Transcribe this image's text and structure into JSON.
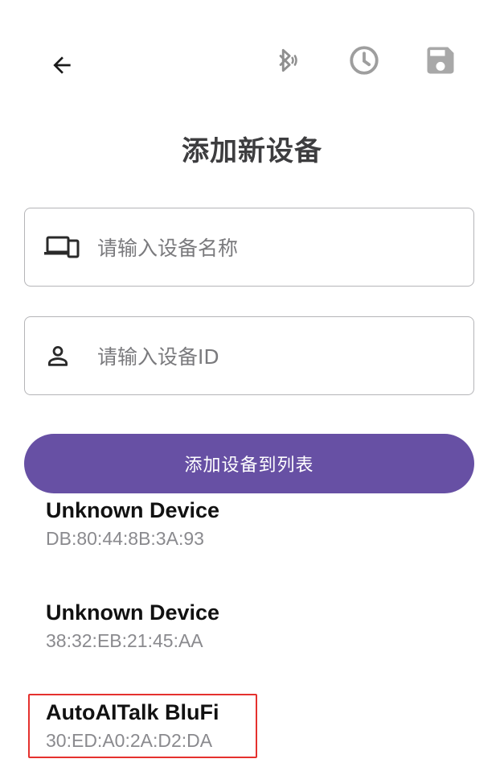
{
  "header": {
    "back_icon": "arrow-left-icon",
    "bluetooth_icon": "bluetooth-scan-icon",
    "history_icon": "clock-icon",
    "save_icon": "floppy-disk-icon"
  },
  "page_title": "添加新设备",
  "form": {
    "name_field": {
      "icon": "devices-icon",
      "placeholder": "请输入设备名称",
      "value": ""
    },
    "id_field": {
      "icon": "person-icon",
      "placeholder": "请输入设备ID",
      "value": ""
    },
    "submit_label": "添加设备到列表"
  },
  "devices": [
    {
      "name": "Unknown Device",
      "mac": "DB:80:44:8B:3A:93"
    },
    {
      "name": "Unknown Device",
      "mac": "38:32:EB:21:45:AA"
    },
    {
      "name": "AutoAITalk BluFi",
      "mac": "30:ED:A0:2A:D2:DA"
    }
  ],
  "colors": {
    "primary": "#6750a4",
    "highlight": "#e5312e",
    "disabled_icon": "#9e9e9e"
  }
}
